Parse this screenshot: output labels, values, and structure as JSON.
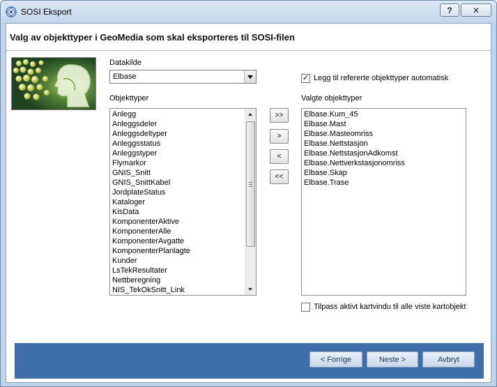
{
  "window": {
    "title": "SOSI Eksport",
    "help_label": "?",
    "close_label": "✕"
  },
  "heading": "Valg av objekttyper i GeoMedia som skal eksporteres til SOSI-filen",
  "datasource": {
    "label": "Datakilde",
    "value": "Elbase"
  },
  "auto_ref": {
    "label": "Legg til refererte objekttyper automatisk",
    "checked_mark": "✓"
  },
  "object_types": {
    "label": "Objekttyper",
    "items": [
      "Anlegg",
      "Anleggsdeler",
      "Anleggsdeltyper",
      "Anleggsstatus",
      "Anleggstyper",
      "Flymarkor",
      "GNIS_Snitt",
      "GNIS_SnittKabel",
      "JordplateStatus",
      "Kataloger",
      "KisData",
      "KomponenterAktive",
      "KomponenterAlle",
      "KomponenterAvgatte",
      "KomponenterPlanlagte",
      "Kunder",
      "LsTekResultater",
      "Nettberegning",
      "NIS_TekOkSnitt_Link"
    ]
  },
  "selected_types": {
    "label": "Valgte objekttyper",
    "items": [
      "Elbase.Kum_45",
      "Elbase.Mast",
      "Elbase.Masteomriss",
      "Elbase.Nettstasjon",
      "Elbase.NettstasjonAdkomst",
      "Elbase.Nettverkstasjonomriss",
      "Elbase.Skap",
      "Elbase.Trase"
    ]
  },
  "move_buttons": {
    "add_all": ">>",
    "add": ">",
    "remove": "<",
    "remove_all": "<<"
  },
  "fit_map": {
    "label": "Tilpass aktivt kartvindu til alle viste kartobjekt",
    "checked_mark": ""
  },
  "nav": {
    "back": "< Forrige",
    "next": "Neste >",
    "cancel": "Avbryt"
  }
}
